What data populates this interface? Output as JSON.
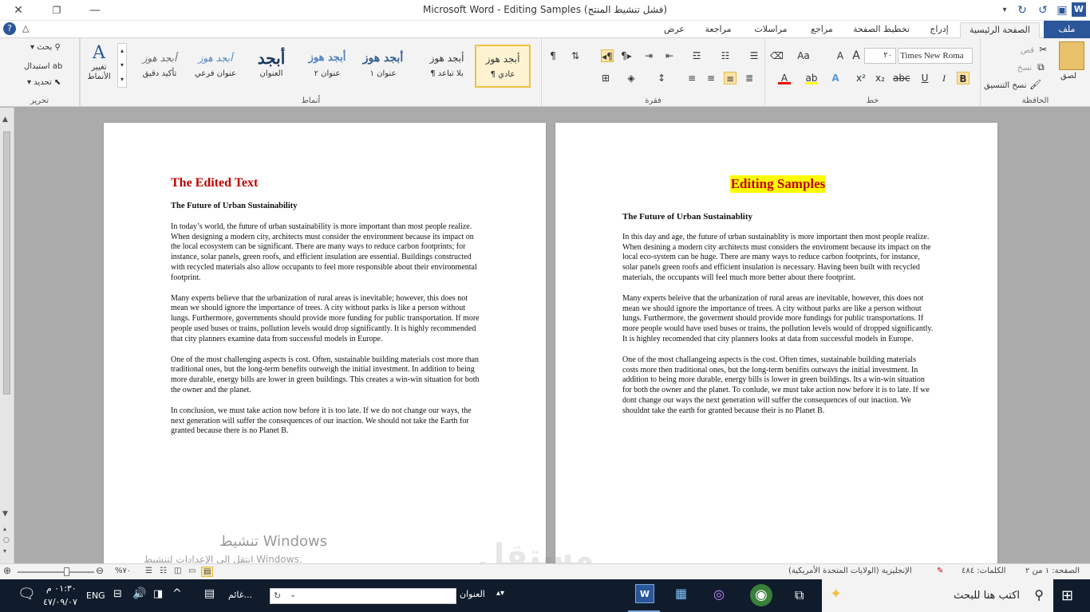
{
  "window": {
    "title": "Microsoft Word  -  Editing Samples (فشل تنشيط المنتج)"
  },
  "tabs": [
    "ملف",
    "الصفحة الرئيسية",
    "إدراج",
    "تخطيط الصفحة",
    "مراجع",
    "مراسلات",
    "مراجعة",
    "عرض"
  ],
  "ribbon": {
    "clipboard": {
      "label": "الحافظة",
      "paste": "لصق",
      "cut": "قص",
      "copy": "نسخ",
      "format_painter": "نسخ التنسيق"
    },
    "font": {
      "label": "خط",
      "font_name": "Times New Roma",
      "font_size": "٢٠"
    },
    "paragraph": {
      "label": "فقرة"
    },
    "styles": {
      "label": "أنماط",
      "items": [
        {
          "preview": "أبجد هوز",
          "name": "¶ عادي"
        },
        {
          "preview": "أبجد هوز",
          "name": "¶ بلا تباعد"
        },
        {
          "preview": "أبجد هوز",
          "name": "عنوان ١"
        },
        {
          "preview": "أبجد هوز",
          "name": "عنوان ٢"
        },
        {
          "preview": "أبجد",
          "name": "العنوان"
        },
        {
          "preview": "أبجد هوز",
          "name": "عنوان فرعي"
        },
        {
          "preview": "أبجد هوز",
          "name": "تأكيد دقيق"
        }
      ],
      "change_styles": "تغيير الأنماط"
    },
    "editing": {
      "label": "تحرير",
      "find": "بحث",
      "replace": "استبدال",
      "select": "تحديد"
    }
  },
  "doc_left": {
    "heading": "The Edited Text",
    "subheading": "The Future of Urban Sustainability",
    "paragraphs": [
      "In today’s world, the future of urban sustainability is more important than most people realize. When designing a modern city, architects must consider the environment because its impact on the local ecosystem can be significant. There are many ways to reduce carbon footprints; for instance, solar panels, green roofs, and efficient insulation are essential. Buildings constructed with recycled materials also allow occupants to feel more responsible about their environmental footprint.",
      "Many experts believe that the urbanization of rural areas is inevitable; however, this does not mean we should ignore the importance of trees. A city without parks is like a person without lungs. Furthermore, governments should provide more funding for public transportation. If more people used buses or trains, pollution levels would drop significantly. It is highly recommended that city planners examine data from successful models in Europe.",
      "One of the most challenging aspects is cost. Often, sustainable building materials cost more than traditional ones, but the long-term benefits outweigh the initial investment. In addition to being more durable, energy bills are lower in green buildings. This creates a win-win situation for both the owner and the planet.",
      "In conclusion, we must take action now before it is too late. If we do not change our ways, the next generation will suffer the consequences of our inaction. We should not take the Earth for granted because there is no Planet B."
    ]
  },
  "doc_right": {
    "heading": "Editing Samples",
    "subheading": "The Future of Urban Sustainablity",
    "paragraphs": [
      "In this day and age, the future of urban sustainablity is more important then most people realize. When desining a modern city architects must considers the enviroment because its impact on the local eco-system can be huge. There are many ways to reduce carbon footprints, for instance, solar panels green roofs and efficient insulation is necessary. Having been built with recycled materials, the occupants will feel much more better about there footprint.",
      "Many experts beleive that the urbanization of rural areas are inevitable, however, this does not mean we should ignore the importance of trees. A city without parks are like a person without lungs. Furthermore, the goverment should provide more fundings for public transportations. If more people would have used buses or trains, the pollution levels would of dropped significantly. It is highley recomended that city planners looks at data from successful models in Europe.",
      "One of the most challangeing aspects is the cost. Often times, sustainable building materials costs more then traditional ones, but the long-term benifits outwavs the initial investment. In addition to being more durable, energy bills is lower in green buildings. Its a win-win situation for both the owner and the planet. To conlude, we must take action now before it is to late. If we dont change our ways the next generation will suffer the consequences of our inaction. We shouldnt take the earth for granted because their is no Planet B."
    ]
  },
  "watermark": {
    "line1": "تنشيط Windows",
    "line2": "انتقل إلى الإعدادات لتنشيط Windows.",
    "brand": "مستقل",
    "brand_url": "mostaql.com"
  },
  "status": {
    "page": "الصفحة: ١ من ٢",
    "words": "الكلمات: ٤٨٤",
    "language": "الإنجليزية (الولايات المتحدة الأمريكية)",
    "zoom": "%٧٠"
  },
  "taskbar": {
    "search_placeholder": "اكتب هنا للبحث",
    "address_label": "العنوان",
    "time": "٠١:٣٠ م",
    "date": "٤٧/٠٩/٠٧",
    "lang": "ENG",
    "weather": "غائم..."
  }
}
